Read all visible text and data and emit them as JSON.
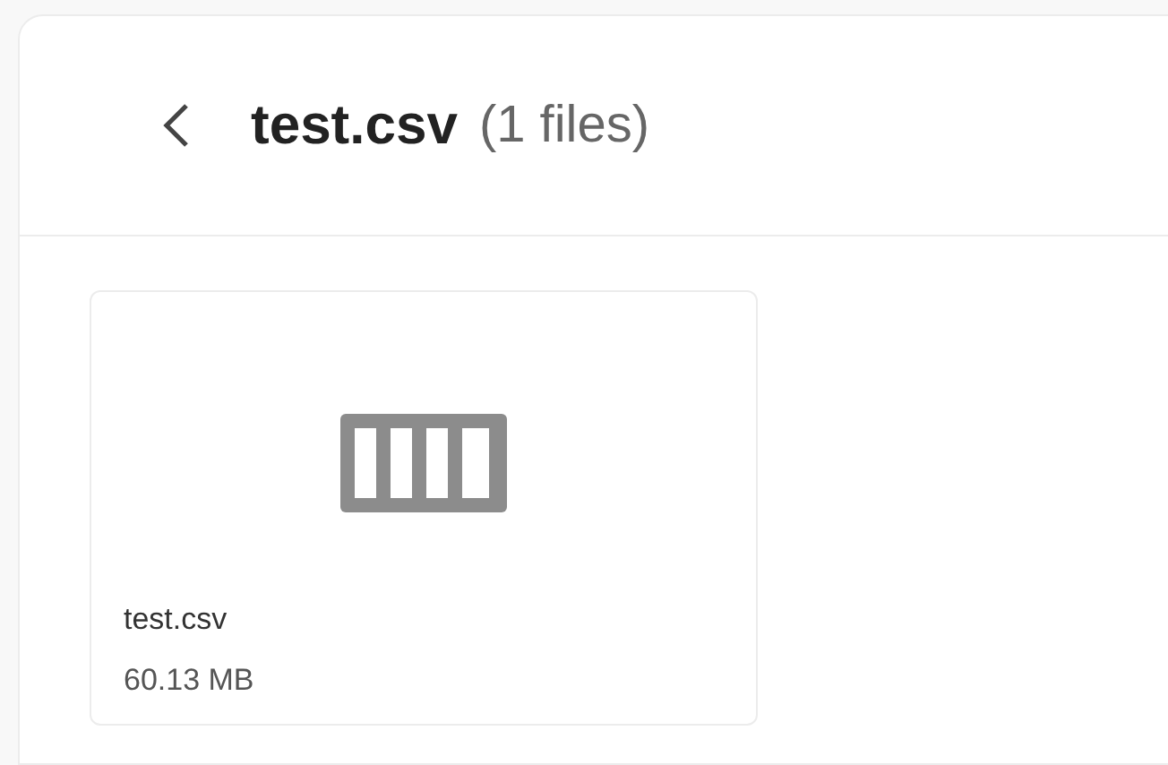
{
  "header": {
    "title": "test.csv",
    "count": "(1 files)"
  },
  "files": [
    {
      "name": "test.csv",
      "size": "60.13 MB",
      "kind": "csv"
    }
  ]
}
